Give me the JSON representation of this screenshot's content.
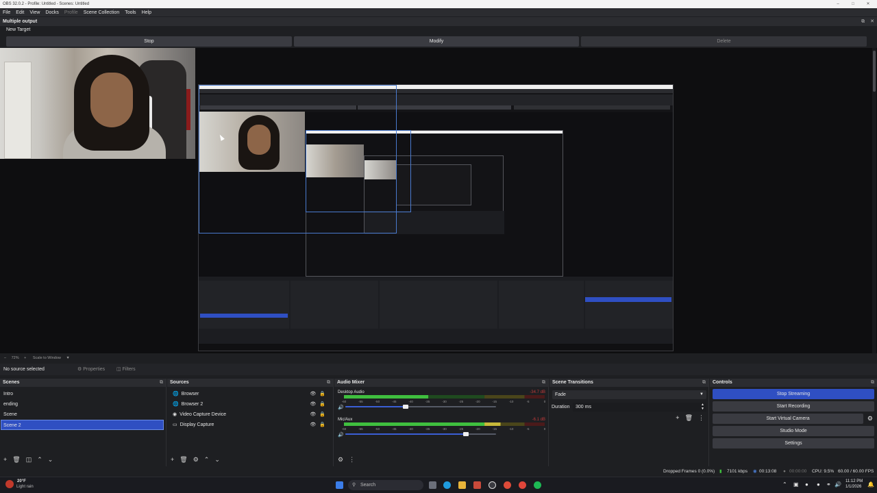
{
  "window": {
    "title": "OBS 32.0.2 - Profile: Untitled - Scenes: Untitled"
  },
  "menu": {
    "file": "File",
    "edit": "Edit",
    "view": "View",
    "docks": "Docks",
    "profile": "Profile",
    "scene_collection": "Scene Collection",
    "tools": "Tools",
    "help": "Help"
  },
  "multiple_output": {
    "title": "Multiple output",
    "target": "New Target",
    "stop": "Stop",
    "modify": "Modify",
    "delete": "Delete"
  },
  "preview": {
    "zoom": "72%",
    "scale_mode": "Scale to Window"
  },
  "source_bar": {
    "no_source": "No source selected",
    "properties": "Properties",
    "filters": "Filters"
  },
  "scenes": {
    "title": "Scenes",
    "items": [
      "Intro",
      "ending",
      "Scene",
      "Scene 2"
    ],
    "selected_index": 3
  },
  "sources": {
    "title": "Sources",
    "items": [
      {
        "name": "Browser",
        "icon": "globe-icon"
      },
      {
        "name": "Browser 2",
        "icon": "globe-icon"
      },
      {
        "name": "Video Capture Device",
        "icon": "camera-icon"
      },
      {
        "name": "Display Capture",
        "icon": "monitor-icon"
      }
    ]
  },
  "audio_mixer": {
    "title": "Audio Mixer",
    "channels": [
      {
        "name": "Desktop Audio",
        "db": "-34.7 dB",
        "level": 0.42,
        "fader": 0.4
      },
      {
        "name": "Mic/Aux",
        "db": "-6.1 dB",
        "level": 0.78,
        "fader": 0.8
      }
    ],
    "scale": [
      "-60",
      "-55",
      "-50",
      "-45",
      "-40",
      "-35",
      "-30",
      "-25",
      "-20",
      "-15",
      "-10",
      "-5",
      "0"
    ]
  },
  "transitions": {
    "title": "Scene Transitions",
    "type": "Fade",
    "duration_label": "Duration",
    "duration": "300 ms"
  },
  "controls": {
    "title": "Controls",
    "stop_streaming": "Stop Streaming",
    "start_recording": "Start Recording",
    "start_virtual_camera": "Start Virtual Camera",
    "studio_mode": "Studio Mode",
    "settings": "Settings"
  },
  "status": {
    "dropped": "Dropped Frames 0 (0.0%)",
    "bitrate": "7101 kbps",
    "stream_time": "00:13:08",
    "rec_time": "00:00:00",
    "cpu": "CPU: 9.5%",
    "fps": "60.00 / 60.00 FPS"
  },
  "taskbar": {
    "weather_temp": "20°F",
    "weather_text": "Light rain",
    "search": "Search",
    "time": "11:12 PM",
    "date": "1/1/2026"
  },
  "colors": {
    "accent": "#2f4fc2",
    "meter_green": "#3fbf3f",
    "meter_yellow": "#c8b93a",
    "meter_red": "#c03a3a"
  }
}
